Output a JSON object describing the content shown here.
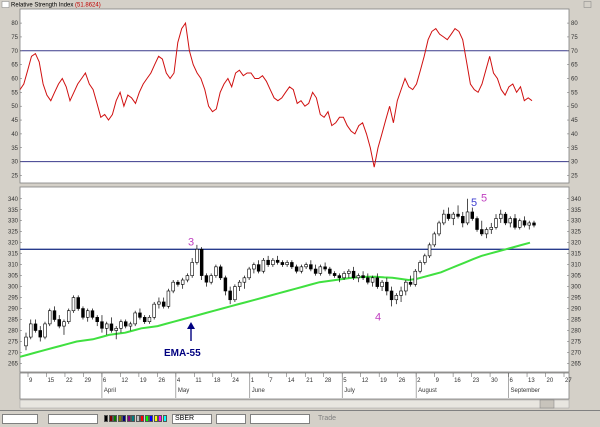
{
  "window": {
    "title": "Relative Strength Index",
    "title_value": "(51.8624)"
  },
  "chart_data": [
    {
      "type": "line",
      "name": "rsi-panel",
      "title": "Relative Strength Index",
      "current_value": 51.8624,
      "ylim": [
        23,
        84
      ],
      "yticks": [
        25,
        30,
        35,
        40,
        45,
        50,
        55,
        60,
        65,
        70,
        75,
        80
      ],
      "reference_lines": [
        70,
        30
      ],
      "series": [
        {
          "color": "#d01010",
          "values": [
            56,
            58,
            63,
            68,
            69,
            66,
            58,
            54,
            52,
            55,
            58,
            60,
            57,
            52,
            55,
            58,
            60,
            62,
            58,
            56,
            51,
            46,
            47,
            45,
            47,
            52,
            55,
            50,
            54,
            53,
            51,
            55,
            58,
            60,
            62,
            65,
            68,
            67,
            62,
            60,
            62,
            73,
            78,
            80,
            70,
            65,
            62,
            60,
            56,
            50,
            48,
            49,
            55,
            58,
            60,
            57,
            62,
            63,
            61,
            62,
            62,
            60,
            60,
            61,
            59,
            56,
            53,
            52,
            53,
            55,
            57,
            56,
            51,
            52,
            50,
            51,
            55,
            53,
            47,
            46,
            48,
            43,
            44,
            46,
            46,
            43,
            41,
            40,
            43,
            44,
            40,
            35,
            28,
            35,
            40,
            45,
            50,
            44,
            52,
            56,
            60,
            57,
            56,
            58,
            63,
            68,
            74,
            77,
            78,
            76,
            75,
            74,
            76,
            78,
            77,
            74,
            66,
            58,
            56,
            55,
            58,
            63,
            68,
            62,
            60,
            56,
            54,
            57,
            58,
            55,
            57,
            52,
            53,
            52
          ]
        }
      ]
    },
    {
      "type": "candlestick",
      "name": "price-panel",
      "ylim": [
        262,
        344
      ],
      "yticks": [
        265,
        270,
        275,
        280,
        285,
        290,
        295,
        300,
        305,
        310,
        315,
        320,
        325,
        330,
        335,
        340
      ],
      "reference_lines": [
        317
      ],
      "x_tick_labels": [
        "9",
        "15",
        "22",
        "29",
        "6",
        "12",
        "19",
        "26",
        "4",
        "11",
        "18",
        "24",
        "1",
        "7",
        "14",
        "21",
        "28",
        "5",
        "12",
        "19",
        "26",
        "2",
        "9",
        "16",
        "23",
        "30",
        "6",
        "13",
        "20",
        "27"
      ],
      "month_labels": [
        "April",
        "May",
        "June",
        "July",
        "August",
        "September"
      ],
      "annotations": [
        {
          "text": "3",
          "color": "#c040c0",
          "value": 316
        },
        {
          "text": "4",
          "color": "#c040c0",
          "value": 290
        },
        {
          "text": "5",
          "color": "#4040d0",
          "value": 334
        },
        {
          "text": "5",
          "color": "#c040c0",
          "value": 336
        },
        {
          "text": "EMA-55",
          "color": "#000080",
          "value": 284
        }
      ],
      "ema": {
        "name": "EMA-55",
        "color": "#40e040",
        "values": [
          268,
          269,
          270,
          271,
          272,
          273,
          274,
          275,
          275.5,
          276,
          277,
          278,
          278.5,
          279,
          280,
          281,
          281.5,
          282,
          283,
          284,
          285,
          286,
          287,
          288,
          289,
          290,
          291,
          292,
          293,
          294,
          295,
          296,
          297,
          298,
          299,
          300,
          301,
          302,
          302.5,
          303,
          303.5,
          304,
          304.3,
          304.5,
          304.5,
          304.2,
          304,
          303.5,
          303,
          303.5,
          304.5,
          305.5,
          306.5,
          308,
          309.5,
          311,
          312.5,
          314,
          315,
          316,
          317,
          318,
          319,
          320
        ]
      },
      "ohlc": [
        [
          273,
          279,
          271,
          277
        ],
        [
          277,
          285,
          276,
          283
        ],
        [
          283,
          285,
          279,
          280
        ],
        [
          280,
          282,
          275,
          277
        ],
        [
          277,
          284,
          276,
          283
        ],
        [
          283,
          290,
          282,
          289
        ],
        [
          289,
          291,
          284,
          285
        ],
        [
          285,
          287,
          281,
          282
        ],
        [
          282,
          285,
          278,
          284
        ],
        [
          284,
          290,
          283,
          289
        ],
        [
          289,
          296,
          288,
          295
        ],
        [
          295,
          296,
          289,
          290
        ],
        [
          290,
          291,
          285,
          286
        ],
        [
          286,
          290,
          284,
          289
        ],
        [
          289,
          290,
          285,
          286
        ],
        [
          286,
          287,
          282,
          284
        ],
        [
          284,
          287,
          279,
          281
        ],
        [
          281,
          284,
          278,
          283
        ],
        [
          283,
          286,
          279,
          280
        ],
        [
          280,
          282,
          276,
          281
        ],
        [
          281,
          285,
          279,
          284
        ],
        [
          284,
          285,
          281,
          282
        ],
        [
          282,
          284,
          280,
          283
        ],
        [
          283,
          289,
          282,
          288
        ],
        [
          288,
          290,
          285,
          286
        ],
        [
          286,
          287,
          283,
          284
        ],
        [
          284,
          287,
          283,
          286
        ],
        [
          286,
          293,
          285,
          292
        ],
        [
          292,
          295,
          290,
          293
        ],
        [
          293,
          295,
          290,
          291
        ],
        [
          291,
          299,
          290,
          298
        ],
        [
          298,
          303,
          297,
          302
        ],
        [
          302,
          303,
          300,
          301
        ],
        [
          301,
          304,
          299,
          303
        ],
        [
          303,
          306,
          302,
          305
        ],
        [
          305,
          313,
          304,
          311
        ],
        [
          311,
          319,
          310,
          317
        ],
        [
          317,
          318,
          303,
          305
        ],
        [
          305,
          306,
          300,
          302
        ],
        [
          302,
          306,
          301,
          305
        ],
        [
          305,
          310,
          304,
          309
        ],
        [
          309,
          310,
          303,
          304
        ],
        [
          304,
          305,
          296,
          298
        ],
        [
          298,
          300,
          292,
          294
        ],
        [
          294,
          301,
          293,
          300
        ],
        [
          300,
          303,
          298,
          302
        ],
        [
          302,
          305,
          299,
          304
        ],
        [
          304,
          309,
          303,
          308
        ],
        [
          308,
          311,
          306,
          310
        ],
        [
          310,
          312,
          306,
          307
        ],
        [
          307,
          313,
          306,
          312
        ],
        [
          312,
          314,
          309,
          310
        ],
        [
          310,
          313,
          309,
          312
        ],
        [
          312,
          314,
          310,
          311
        ],
        [
          311,
          312,
          309,
          310
        ],
        [
          310,
          312,
          309,
          311
        ],
        [
          311,
          312,
          308,
          309
        ],
        [
          309,
          310,
          306,
          307
        ],
        [
          307,
          310,
          306,
          309
        ],
        [
          309,
          311,
          308,
          310
        ],
        [
          310,
          312,
          307,
          308
        ],
        [
          308,
          310,
          305,
          306
        ],
        [
          306,
          310,
          305,
          309
        ],
        [
          309,
          311,
          307,
          308
        ],
        [
          308,
          309,
          305,
          306
        ],
        [
          306,
          307,
          304,
          305
        ],
        [
          305,
          306,
          302,
          304
        ],
        [
          304,
          307,
          303,
          306
        ],
        [
          306,
          308,
          304,
          307
        ],
        [
          307,
          309,
          303,
          304
        ],
        [
          304,
          306,
          302,
          305
        ],
        [
          305,
          307,
          303,
          304
        ],
        [
          304,
          306,
          301,
          302
        ],
        [
          302,
          305,
          300,
          304
        ],
        [
          304,
          306,
          299,
          300
        ],
        [
          300,
          303,
          298,
          302
        ],
        [
          302,
          304,
          296,
          298
        ],
        [
          298,
          300,
          291,
          294
        ],
        [
          294,
          297,
          292,
          296
        ],
        [
          296,
          300,
          293,
          298
        ],
        [
          298,
          303,
          296,
          302
        ],
        [
          302,
          305,
          300,
          301
        ],
        [
          301,
          308,
          300,
          307
        ],
        [
          307,
          312,
          306,
          311
        ],
        [
          311,
          315,
          310,
          314
        ],
        [
          314,
          320,
          313,
          319
        ],
        [
          319,
          325,
          318,
          324
        ],
        [
          324,
          330,
          323,
          329
        ],
        [
          329,
          335,
          328,
          333
        ],
        [
          333,
          336,
          330,
          331
        ],
        [
          331,
          334,
          328,
          333
        ],
        [
          333,
          337,
          331,
          332
        ],
        [
          332,
          334,
          327,
          329
        ],
        [
          329,
          340,
          328,
          334
        ],
        [
          334,
          336,
          330,
          331
        ],
        [
          331,
          332,
          325,
          326
        ],
        [
          326,
          330,
          323,
          324
        ],
        [
          324,
          327,
          322,
          326
        ],
        [
          326,
          329,
          324,
          327
        ],
        [
          327,
          333,
          326,
          331
        ],
        [
          331,
          335,
          329,
          333
        ],
        [
          333,
          334,
          328,
          329
        ],
        [
          329,
          332,
          327,
          331
        ],
        [
          331,
          333,
          326,
          327
        ],
        [
          327,
          331,
          326,
          330
        ],
        [
          330,
          332,
          327,
          328
        ],
        [
          328,
          330,
          326,
          329
        ],
        [
          329,
          330,
          327,
          328
        ]
      ]
    }
  ],
  "axis": {
    "x_tick_labels": [
      "9",
      "15",
      "22",
      "29",
      "6",
      "12",
      "19",
      "26",
      "4",
      "11",
      "18",
      "24",
      "1",
      "7",
      "14",
      "21",
      "28",
      "5",
      "12",
      "19",
      "26",
      "2",
      "9",
      "16",
      "23",
      "30",
      "6",
      "13",
      "20",
      "27"
    ],
    "month_labels": [
      "April",
      "May",
      "June",
      "July",
      "August",
      "September"
    ]
  },
  "statusbar": {
    "symbol": "SBER",
    "trade_label": "Trade",
    "colors": [
      "#000000",
      "#800000",
      "#008000",
      "#808000",
      "#000080",
      "#800080",
      "#008080",
      "#c0c0c0",
      "#ff0000",
      "#00ff00",
      "#0000ff",
      "#ffff00",
      "#ff00ff",
      "#00ffff"
    ]
  }
}
